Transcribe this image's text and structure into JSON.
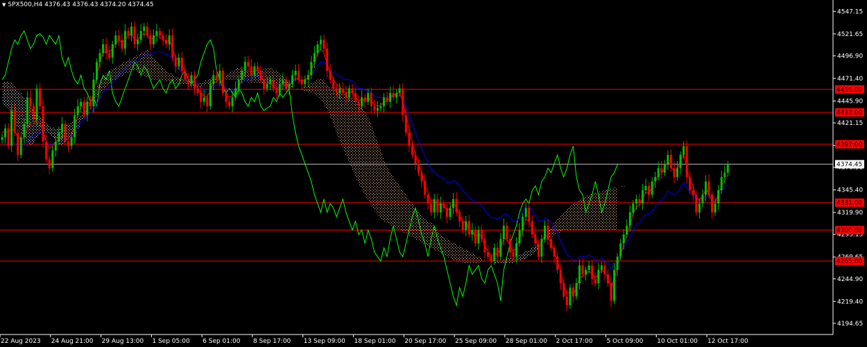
{
  "header": {
    "symbol": "SPX500,H4",
    "open": "4376.43",
    "high": "4376.43",
    "low": "4374.20",
    "close": "4374.45"
  },
  "colors": {
    "background": "#000000",
    "bull_candle": "#00c000",
    "bear_candle": "#ff0000",
    "tenkan": "#ff0000",
    "kijun": "#0000ff",
    "chikou": "#00ff00",
    "cloud_up": "#ffcc99",
    "cloud_down": "#ffffff",
    "level_line": "#ff0000",
    "price_line": "#c0c0c0"
  },
  "chart_data": {
    "type": "line",
    "ylim": [
      4182,
      4560
    ],
    "y_ticks": [
      "4547.15",
      "4521.65",
      "4496.90",
      "4471.40",
      "4445.90",
      "4421.15",
      "4395.65",
      "4370.90",
      "4345.40",
      "4319.90",
      "4295.15",
      "4269.65",
      "4244.90",
      "4219.40",
      "4194.65"
    ],
    "y_tick_values": [
      4547.15,
      4521.65,
      4496.9,
      4471.4,
      4445.9,
      4421.15,
      4395.65,
      4370.9,
      4345.4,
      4319.9,
      4295.15,
      4269.65,
      4244.9,
      4219.4,
      4194.65
    ],
    "x_labels": [
      "22 Aug 2023",
      "24 Aug 21:00",
      "29 Aug 13:00",
      "1 Sep 05:00",
      "6 Sep 01:00",
      "8 Sep 17:00",
      "13 Sep 09:00",
      "18 Sep 01:00",
      "20 Sep 17:00",
      "25 Sep 09:00",
      "28 Sep 01:00",
      "2 Oct 17:00",
      "5 Oct 09:00",
      "10 Oct 01:00",
      "12 Oct 17:00"
    ],
    "x_label_index": [
      0,
      16,
      32,
      48,
      64,
      80,
      96,
      112,
      128,
      144,
      160,
      176,
      192,
      208,
      224
    ],
    "bars_total": 264,
    "current_price": "4374.45",
    "current_price_value": 4374.45,
    "levels": [
      {
        "label": "4459.00",
        "value": 4459.0
      },
      {
        "label": "4433.00",
        "value": 4433.0
      },
      {
        "label": "4397.00",
        "value": 4397.0
      },
      {
        "label": "4331.00",
        "value": 4331.0
      },
      {
        "label": "4300.00",
        "value": 4300.0
      },
      {
        "label": "4265.00",
        "value": 4265.0
      }
    ],
    "close": [
      4405,
      4415,
      4395,
      4435,
      4410,
      4385,
      4405,
      4420,
      4450,
      4440,
      4425,
      4460,
      4440,
      4400,
      4380,
      4370,
      4390,
      4400,
      4410,
      4420,
      4400,
      4395,
      4405,
      4430,
      4440,
      4445,
      4430,
      4445,
      4440,
      4470,
      4490,
      4500,
      4510,
      4500,
      4495,
      4510,
      4520,
      4515,
      4505,
      4525,
      4520,
      4530,
      4510,
      4515,
      4525,
      4530,
      4520,
      4510,
      4520,
      4525,
      4520,
      4515,
      4510,
      4520,
      4495,
      4485,
      4495,
      4480,
      4470,
      4465,
      4475,
      4460,
      4455,
      4445,
      4450,
      4440,
      4465,
      4475,
      4470,
      4480,
      4455,
      4445,
      4440,
      4450,
      4460,
      4470,
      4480,
      4490,
      4485,
      4475,
      4485,
      4480,
      4470,
      4460,
      4465,
      4470,
      4460,
      4455,
      4465,
      4470,
      4460,
      4465,
      4475,
      4480,
      4470,
      4465,
      4470,
      4475,
      4490,
      4500,
      4510,
      4515,
      4505,
      4480,
      4470,
      4460,
      4455,
      4460,
      4455,
      4450,
      4460,
      4455,
      4445,
      4440,
      4450,
      4445,
      4455,
      4440,
      4435,
      4438,
      4440,
      4450,
      4445,
      4455,
      4450,
      4455,
      4460,
      4430,
      4410,
      4395,
      4385,
      4375,
      4365,
      4355,
      4340,
      4330,
      4320,
      4335,
      4320,
      4330,
      4325,
      4315,
      4325,
      4335,
      4320,
      4310,
      4300,
      4310,
      4295,
      4300,
      4285,
      4300,
      4290,
      4275,
      4270,
      4265,
      4280,
      4270,
      4290,
      4305,
      4290,
      4275,
      4270,
      4285,
      4300,
      4315,
      4325,
      4310,
      4295,
      4285,
      4270,
      4290,
      4305,
      4290,
      4280,
      4270,
      4255,
      4240,
      4225,
      4215,
      4235,
      4225,
      4240,
      4260,
      4250,
      4255,
      4260,
      4245,
      4240,
      4255,
      4260,
      4250,
      4240,
      4220,
      4255,
      4270,
      4285,
      4295,
      4305,
      4320,
      4330,
      4335,
      4330,
      4345,
      4350,
      4340,
      4355,
      4360,
      4370,
      4365,
      4375,
      4385,
      4370,
      4360,
      4370,
      4385,
      4395,
      4360,
      4345,
      4340,
      4320,
      4330,
      4340,
      4355,
      4340,
      4320,
      4330,
      4345,
      4360,
      4365,
      4374
    ],
    "tenkan": [
      4410,
      4412,
      4410,
      4415,
      4412,
      4405,
      4402,
      4405,
      4415,
      4420,
      4420,
      4425,
      4420,
      4412,
      4400,
      4392,
      4395,
      4400,
      4402,
      4405,
      4408,
      4405,
      4408,
      4418,
      4430,
      4440,
      4440,
      4445,
      4442,
      4455,
      4475,
      4490,
      4500,
      4502,
      4502,
      4505,
      4512,
      4515,
      4512,
      4515,
      4520,
      4522,
      4515,
      4515,
      4520,
      4522,
      4520,
      4515,
      4518,
      4520,
      4518,
      4515,
      4512,
      4515,
      4505,
      4495,
      4492,
      4488,
      4478,
      4470,
      4470,
      4465,
      4460,
      4455,
      4452,
      4450,
      4458,
      4466,
      4468,
      4472,
      4465,
      4455,
      4450,
      4452,
      4456,
      4462,
      4470,
      4478,
      4480,
      4478,
      4480,
      4480,
      4475,
      4468,
      4465,
      4466,
      4462,
      4460,
      4462,
      4465,
      4462,
      4463,
      4468,
      4472,
      4470,
      4468,
      4470,
      4472,
      4480,
      4490,
      4500,
      4505,
      4500,
      4488,
      4478,
      4470,
      4465,
      4462,
      4458,
      4455,
      4456,
      4456,
      4450,
      4446,
      4448,
      4446,
      4450,
      4446,
      4442,
      4440,
      4441,
      4445,
      4446,
      4450,
      4452,
      4454,
      4456,
      4445,
      4430,
      4415,
      4400,
      4385,
      4375,
      4365,
      4352,
      4342,
      4332,
      4335,
      4328,
      4330,
      4328,
      4322,
      4325,
      4330,
      4326,
      4318,
      4308,
      4310,
      4300,
      4300,
      4292,
      4296,
      4292,
      4282,
      4276,
      4270,
      4274,
      4272,
      4280,
      4290,
      4290,
      4282,
      4276,
      4280,
      4290,
      4302,
      4312,
      4310,
      4302,
      4292,
      4280,
      4285,
      4295,
      4292,
      4285,
      4276,
      4265,
      4252,
      4238,
      4228,
      4230,
      4228,
      4234,
      4246,
      4248,
      4250,
      4254,
      4250,
      4246,
      4250,
      4255,
      4252,
      4246,
      4234,
      4245,
      4258,
      4272,
      4284,
      4294,
      4306,
      4318,
      4326,
      4328,
      4336,
      4342,
      4342,
      4348,
      4354,
      4362,
      4364,
      4370,
      4378,
      4372,
      4366,
      4368,
      4378,
      4386,
      4370,
      4356,
      4350,
      4336,
      4335,
      4338,
      4346,
      4342,
      4332,
      4332,
      4340,
      4350,
      4356,
      4362
    ],
    "kijun": [
      4395,
      4396,
      4395,
      4397,
      4398,
      4395,
      4394,
      4395,
      4400,
      4405,
      4406,
      4410,
      4410,
      4406,
      4400,
      4396,
      4396,
      4398,
      4400,
      4402,
      4404,
      4404,
      4405,
      4410,
      4416,
      4422,
      4425,
      4430,
      4432,
      4436,
      4442,
      4450,
      4456,
      4460,
      4462,
      4466,
      4472,
      4476,
      4478,
      4482,
      4486,
      4490,
      4490,
      4492,
      4496,
      4498,
      4498,
      4498,
      4500,
      4502,
      4502,
      4500,
      4498,
      4498,
      4492,
      4486,
      4482,
      4478,
      4474,
      4470,
      4470,
      4468,
      4465,
      4460,
      4458,
      4456,
      4458,
      4462,
      4464,
      4466,
      4464,
      4460,
      4458,
      4458,
      4460,
      4462,
      4466,
      4470,
      4472,
      4472,
      4474,
      4474,
      4472,
      4470,
      4468,
      4468,
      4466,
      4465,
      4465,
      4466,
      4466,
      4466,
      4468,
      4470,
      4470,
      4470,
      4470,
      4472,
      4476,
      4480,
      4486,
      4490,
      4490,
      4486,
      4482,
      4478,
      4476,
      4474,
      4472,
      4470,
      4470,
      4468,
      4464,
      4460,
      4460,
      4458,
      4458,
      4455,
      4452,
      4450,
      4450,
      4450,
      4450,
      4452,
      4452,
      4452,
      4452,
      4448,
      4440,
      4430,
      4420,
      4410,
      4400,
      4392,
      4384,
      4376,
      4368,
      4366,
      4362,
      4360,
      4358,
      4354,
      4354,
      4356,
      4354,
      4350,
      4344,
      4342,
      4336,
      4334,
      4330,
      4330,
      4328,
      4322,
      4318,
      4314,
      4314,
      4312,
      4314,
      4318,
      4318,
      4314,
      4310,
      4310,
      4314,
      4320,
      4326,
      4326,
      4322,
      4316,
      4310,
      4310,
      4314,
      4312,
      4308,
      4302,
      4296,
      4288,
      4280,
      4272,
      4270,
      4266,
      4266,
      4270,
      4270,
      4270,
      4272,
      4270,
      4266,
      4266,
      4268,
      4266,
      4262,
      4256,
      4260,
      4266,
      4274,
      4280,
      4286,
      4292,
      4300,
      4306,
      4308,
      4314,
      4318,
      4318,
      4322,
      4326,
      4332,
      4334,
      4338,
      4344,
      4342,
      4340,
      4342,
      4348,
      4354,
      4348,
      4342,
      4340,
      4334,
      4334,
      4336,
      4340,
      4338,
      4334,
      4334,
      4338,
      4344,
      4348,
      4352
    ],
    "span_a": [
      4445,
      4440,
      4438,
      4430,
      4420,
      4415,
      4410,
      4405,
      4400,
      4395,
      4398,
      4405,
      4410,
      4412,
      4410,
      4408,
      4405,
      4400,
      4398,
      4395,
      4398,
      4402,
      4405,
      4408,
      4412,
      4420,
      4428,
      4436,
      4445,
      4455,
      4462,
      4468,
      4474,
      4478,
      4480,
      4482,
      4484,
      4486,
      4488,
      4490,
      4492,
      4494,
      4496,
      4498,
      4500,
      4502,
      4504,
      4500,
      4496,
      4492,
      4488,
      4484,
      4480,
      4478,
      4476,
      4474,
      4472,
      4472,
      4470,
      4470,
      4468,
      4466,
      4466,
      4466,
      4468,
      4470,
      4472,
      4472,
      4470,
      4468,
      4470,
      4474,
      4478,
      4480,
      4482,
      4484,
      4482,
      4480,
      4478,
      4476,
      4476,
      4478,
      4480,
      4482,
      4484,
      4484,
      4482,
      4480,
      4478,
      4474,
      4470,
      4466,
      4462,
      4460,
      4458,
      4460,
      4462,
      4464,
      4466,
      4468,
      4470,
      4472,
      4470,
      4466,
      4462,
      4460,
      4458,
      4456,
      4454,
      4452,
      4450,
      4448,
      4446,
      4444,
      4440,
      4434,
      4428,
      4420,
      4410,
      4400,
      4390,
      4380,
      4372,
      4366,
      4360,
      4355,
      4350,
      4345,
      4340,
      4335,
      4330,
      4325,
      4320,
      4316,
      4312,
      4310,
      4308,
      4305,
      4300,
      4296,
      4292,
      4290,
      4288,
      4286,
      4284,
      4282,
      4280,
      4278,
      4276,
      4274,
      4272,
      4270,
      4268,
      4266,
      4265,
      4264,
      4263,
      4262,
      4262,
      4262,
      4262,
      4262,
      4263,
      4264,
      4265,
      4266,
      4268,
      4270,
      4272,
      4275,
      4280,
      4286,
      4292,
      4298,
      4303,
      4308,
      4312,
      4316,
      4320,
      4324,
      4327,
      4330,
      4332,
      4334,
      4336,
      4338,
      4340,
      4341,
      4342,
      4343,
      4344,
      4345,
      4346,
      4347,
      4348,
      4348,
      4349,
      4350,
      4350
    ],
    "span_b": [
      4468,
      4468,
      4468,
      4466,
      4462,
      4458,
      4455,
      4450,
      4445,
      4440,
      4436,
      4432,
      4428,
      4424,
      4420,
      4418,
      4416,
      4415,
      4415,
      4416,
      4418,
      4420,
      4422,
      4424,
      4426,
      4430,
      4434,
      4438,
      4442,
      4446,
      4450,
      4454,
      4458,
      4462,
      4465,
      4468,
      4470,
      4472,
      4474,
      4476,
      4478,
      4480,
      4480,
      4478,
      4476,
      4474,
      4472,
      4470,
      4470,
      4470,
      4470,
      4469,
      4468,
      4467,
      4466,
      4465,
      4464,
      4464,
      4464,
      4464,
      4463,
      4462,
      4462,
      4462,
      4463,
      4464,
      4465,
      4466,
      4467,
      4468,
      4469,
      4470,
      4470,
      4470,
      4470,
      4470,
      4469,
      4468,
      4467,
      4466,
      4466,
      4466,
      4466,
      4466,
      4466,
      4466,
      4466,
      4465,
      4465,
      4464,
      4463,
      4462,
      4461,
      4460,
      4459,
      4458,
      4457,
      4456,
      4455,
      4454,
      4452,
      4448,
      4442,
      4436,
      4428,
      4420,
      4410,
      4400,
      4392,
      4384,
      4376,
      4368,
      4360,
      4352,
      4346,
      4340,
      4334,
      4328,
      4322,
      4318,
      4314,
      4310,
      4308,
      4306,
      4304,
      4302,
      4300,
      4298,
      4296,
      4294,
      4292,
      4290,
      4288,
      4286,
      4284,
      4282,
      4280,
      4278,
      4276,
      4274,
      4272,
      4270,
      4268,
      4266,
      4265,
      4264,
      4263,
      4262,
      4262,
      4262,
      4262,
      4263,
      4264,
      4265,
      4266,
      4266,
      4266,
      4266,
      4266,
      4267,
      4268,
      4268,
      4269,
      4270,
      4272,
      4274,
      4276,
      4278,
      4280,
      4282,
      4284,
      4286,
      4288,
      4290,
      4292,
      4294,
      4296,
      4298,
      4300,
      4300,
      4300,
      4300,
      4300,
      4300,
      4300,
      4300,
      4300,
      4300,
      4300,
      4300,
      4300,
      4300,
      4300,
      4300,
      4300,
      4300
    ],
    "chikou": [
      4470,
      4475,
      4490,
      4505,
      4515,
      4510,
      4520,
      4525,
      4515,
      4505,
      4510,
      4520,
      4522,
      4518,
      4510,
      4520,
      4515,
      4510,
      4520,
      4495,
      4485,
      4495,
      4480,
      4470,
      4465,
      4475,
      4460,
      4455,
      4445,
      4450,
      4440,
      4465,
      4475,
      4470,
      4480,
      4455,
      4445,
      4440,
      4450,
      4460,
      4470,
      4480,
      4490,
      4485,
      4475,
      4485,
      4480,
      4470,
      4460,
      4465,
      4470,
      4460,
      4455,
      4465,
      4470,
      4460,
      4465,
      4475,
      4480,
      4470,
      4465,
      4470,
      4475,
      4490,
      4500,
      4510,
      4515,
      4505,
      4480,
      4470,
      4460,
      4455,
      4460,
      4455,
      4450,
      4460,
      4455,
      4445,
      4440,
      4450,
      4445,
      4455,
      4440,
      4435,
      4438,
      4440,
      4450,
      4445,
      4455,
      4450,
      4455,
      4460,
      4430,
      4410,
      4395,
      4385,
      4375,
      4365,
      4355,
      4340,
      4330,
      4320,
      4335,
      4320,
      4330,
      4325,
      4315,
      4325,
      4335,
      4320,
      4310,
      4300,
      4310,
      4295,
      4300,
      4285,
      4300,
      4290,
      4275,
      4270,
      4265,
      4280,
      4270,
      4290,
      4305,
      4290,
      4275,
      4270,
      4285,
      4300,
      4315,
      4325,
      4310,
      4295,
      4285,
      4270,
      4290,
      4305,
      4290,
      4280,
      4270,
      4255,
      4240,
      4225,
      4215,
      4235,
      4225,
      4240,
      4260,
      4250,
      4255,
      4260,
      4245,
      4240,
      4255,
      4260,
      4250,
      4240,
      4220,
      4255,
      4270,
      4285,
      4295,
      4305,
      4320,
      4330,
      4335,
      4330,
      4345,
      4350,
      4340,
      4355,
      4360,
      4370,
      4365,
      4375,
      4385,
      4370,
      4360,
      4370,
      4385,
      4395,
      4360,
      4345,
      4340,
      4320,
      4330,
      4340,
      4355,
      4340,
      4320,
      4330,
      4345,
      4360,
      4365,
      4374
    ]
  }
}
